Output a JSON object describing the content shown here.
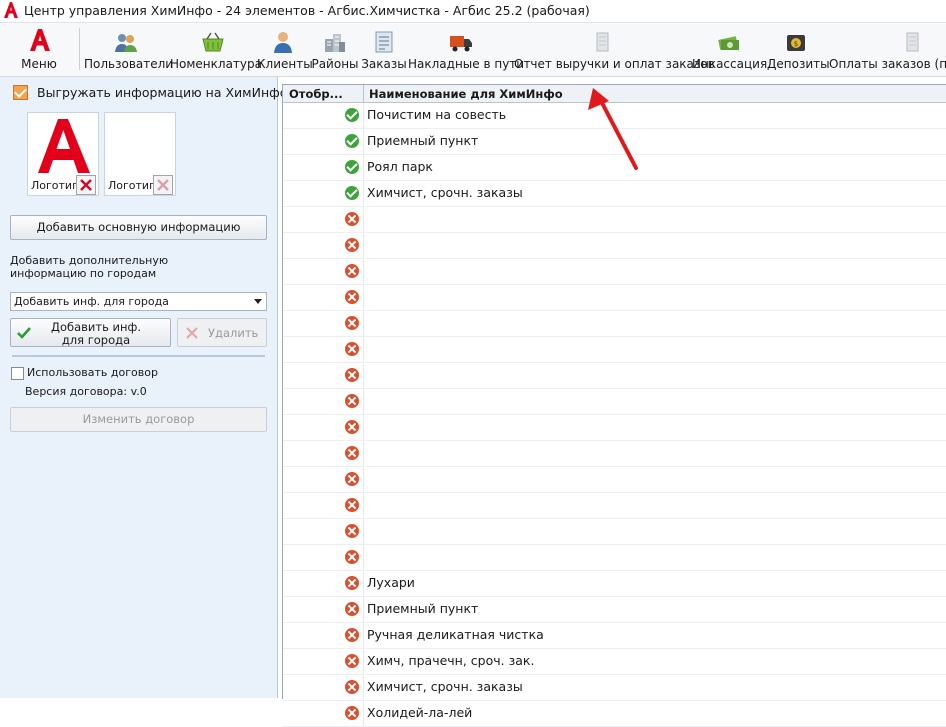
{
  "window": {
    "title": "Центр управления ХимИнфо - 24 элементов - Агбис.Химчистка - Агбис 25.2 (рабочая)"
  },
  "toolbar": {
    "menu_label": "Меню",
    "items": [
      {
        "label": "Пользователи",
        "icon": "users-icon"
      },
      {
        "label": "Номенклатура",
        "icon": "basket-icon"
      },
      {
        "label": "Клиенты",
        "icon": "client-icon"
      },
      {
        "label": "Районы",
        "icon": "districts-icon"
      },
      {
        "label": "Заказы",
        "icon": "orders-icon"
      },
      {
        "label": "Накладные в пути",
        "icon": "truck-icon"
      },
      {
        "label": "Отчет выручки и оплат заказов",
        "icon": "report-icon"
      },
      {
        "label": "Инкассация",
        "icon": "cash-icon"
      },
      {
        "label": "Депозиты",
        "icon": "deposit-icon"
      },
      {
        "label": "Оплаты заказов (по к",
        "icon": "payments-icon"
      }
    ]
  },
  "left": {
    "export_label": "Выгружать информацию на ХимИнфо",
    "export_checked": true,
    "logo1_label": "Логотип",
    "logo2_label": "Логотип",
    "add_main_info": "Добавить основную информацию",
    "additional_info_text": "Добавить дополнительную информацию по городам",
    "city_select_value": "Добавить инф. для города",
    "add_city_button": "Добавить инф. для города",
    "delete_button": "Удалить",
    "use_contract_label": "Использовать договор",
    "use_contract_checked": false,
    "contract_version": "Версия договора: v.0",
    "change_contract_button": "Изменить договор"
  },
  "grid": {
    "col_display": "Отобр...",
    "col_name": "Наименование для ХимИнфо",
    "rows": [
      {
        "status": "ok",
        "name": "Почистим на совесть"
      },
      {
        "status": "ok",
        "name": "Приемный пункт"
      },
      {
        "status": "ok",
        "name": "Роял парк"
      },
      {
        "status": "ok",
        "name": "Химчист, срочн. заказы"
      },
      {
        "status": "no",
        "name": ""
      },
      {
        "status": "no",
        "name": ""
      },
      {
        "status": "no",
        "name": ""
      },
      {
        "status": "no",
        "name": ""
      },
      {
        "status": "no",
        "name": ""
      },
      {
        "status": "no",
        "name": ""
      },
      {
        "status": "no",
        "name": ""
      },
      {
        "status": "no",
        "name": ""
      },
      {
        "status": "no",
        "name": ""
      },
      {
        "status": "no",
        "name": ""
      },
      {
        "status": "no",
        "name": ""
      },
      {
        "status": "no",
        "name": ""
      },
      {
        "status": "no",
        "name": ""
      },
      {
        "status": "no",
        "name": ""
      },
      {
        "status": "no",
        "name": "Лухари"
      },
      {
        "status": "no",
        "name": "Приемный пункт"
      },
      {
        "status": "no",
        "name": "Ручная деликатная чистка"
      },
      {
        "status": "no",
        "name": "Химч, прачечн, сроч. зак."
      },
      {
        "status": "no",
        "name": "Химчист, срочн. заказы"
      },
      {
        "status": "no",
        "name": "Холидей-ла-лей"
      }
    ]
  },
  "colors": {
    "accent": "#e3001b",
    "ok": "#3da43b",
    "no": "#d9502f",
    "annotation_arrow": "#e0191b"
  }
}
